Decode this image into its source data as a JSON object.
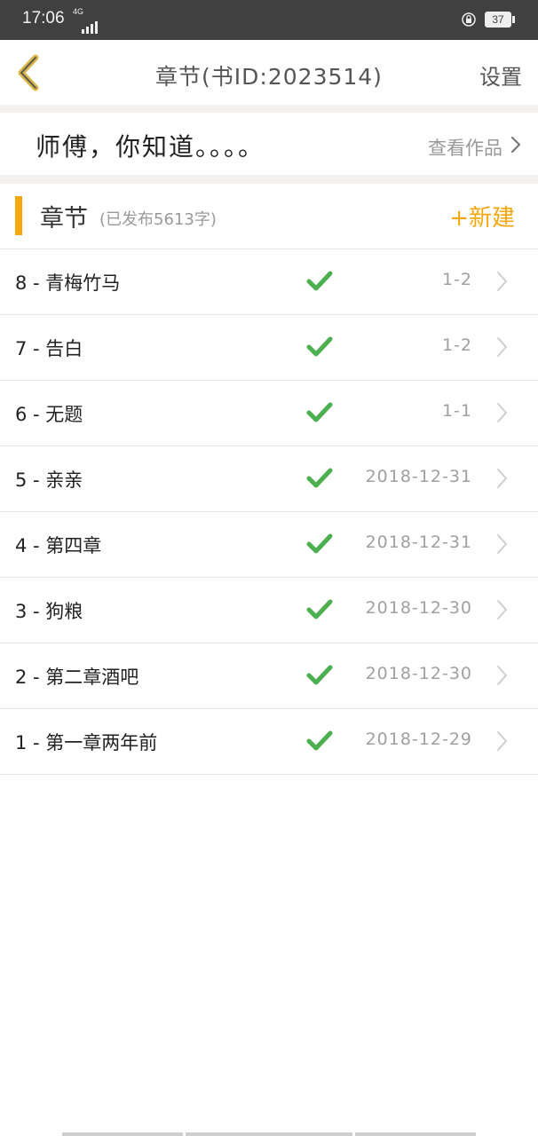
{
  "status_bar": {
    "time": "17:06",
    "network": "4G",
    "battery": "37"
  },
  "header": {
    "title": "章节(书ID:2023514)",
    "settings_label": "设置"
  },
  "book": {
    "title": "师傅，你知道。。。。",
    "view_works_label": "查看作品"
  },
  "section": {
    "title": "章节",
    "meta": "(已发布5613字)",
    "new_label": "+新建"
  },
  "chapters": [
    {
      "label": "8 - 青梅竹马",
      "date": "1-2"
    },
    {
      "label": "7 - 告白",
      "date": "1-2"
    },
    {
      "label": "6 - 无题",
      "date": "1-1"
    },
    {
      "label": "5 - 亲亲",
      "date": "2018-12-31"
    },
    {
      "label": "4 - 第四章",
      "date": "2018-12-31"
    },
    {
      "label": "3 - 狗粮",
      "date": "2018-12-30"
    },
    {
      "label": "2 - 第二章酒吧",
      "date": "2018-12-30"
    },
    {
      "label": "1 - 第一章两年前",
      "date": "2018-12-29"
    }
  ],
  "colors": {
    "accent": "#f6a70c",
    "check": "#4caf50",
    "status_bar": "#404040",
    "band": "#f3f2ef"
  },
  "icons": {
    "back": "chevron-left-icon",
    "status": "check-icon",
    "row": "chevron-right-icon"
  }
}
